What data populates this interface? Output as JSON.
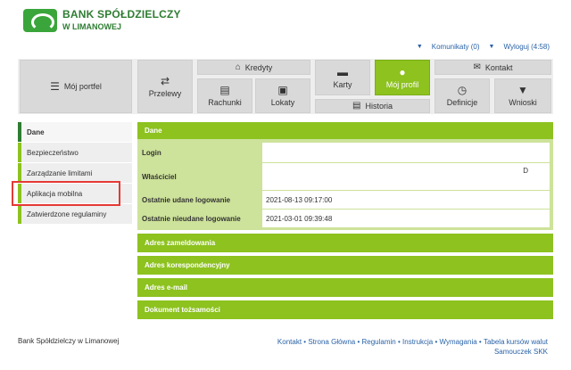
{
  "header": {
    "logo_line1": "BANK SPÓŁDZIELCZY",
    "logo_line2": "W LIMANOWEJ",
    "messages": "Komunikaty (0)",
    "logout": "Wyloguj (4:58)"
  },
  "tiles": {
    "portfolio": "Mój portfel",
    "transfers": "Przelewy",
    "credits": "Kredyty",
    "cards": "Karty",
    "profile": "Mój profil",
    "contact": "Kontakt",
    "accounts": "Rachunki",
    "deposits": "Lokaty",
    "history": "Historia",
    "definitions": "Definicje",
    "applications": "Wnioski"
  },
  "sidebar": {
    "items": [
      "Dane",
      "Bezpieczeństwo",
      "Zarządzanie limitami",
      "Aplikacja mobilna",
      "Zatwierdzone regulaminy"
    ]
  },
  "main": {
    "section_title": "Dane",
    "fields": [
      {
        "label": "Login",
        "value": ""
      },
      {
        "label": "Właściciel",
        "value": "",
        "extra": "D"
      },
      {
        "label": "Ostatnie udane logowanie",
        "value": "2021-08-13 09:17:00"
      },
      {
        "label": "Ostatnie nieudane logowanie",
        "value": "2021-03-01 09:39:48"
      }
    ],
    "sections": [
      "Adres zameldowania",
      "Adres korespondencyjny",
      "Adres e-mail",
      "Dokument tożsamości"
    ]
  },
  "footer": {
    "bank": "Bank Spółdzielczy w Limanowej",
    "links": [
      "Kontakt",
      "Strona Główna",
      "Regulamin",
      "Instrukcja",
      "Wymagania",
      "Tabela kursów walut",
      "Samouczek SKK"
    ]
  },
  "colors": {
    "accent": "#8dc21f",
    "brand": "#2e7d32",
    "link": "#2a63a8",
    "highlight": "#e53935"
  }
}
